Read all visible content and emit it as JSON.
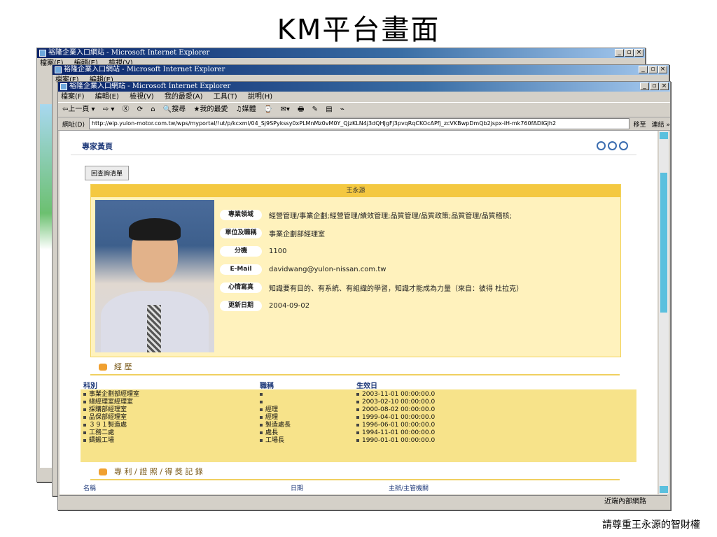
{
  "slide": {
    "title": "KM平台畫面",
    "footer": "請尊重王永源的智財權"
  },
  "browser": {
    "window_title": "裕隆企業入口網站 - Microsoft Internet Explorer",
    "menu": [
      "檔案(F)",
      "編輯(E)",
      "檢視(V)",
      "我的最愛(A)",
      "工具(T)",
      "說明(H)"
    ],
    "toolbar": [
      "⇦上一頁 ▾",
      "⇨ ▾",
      "Ⓧ",
      "⟳",
      "⌂",
      "🔍搜尋",
      "★我的最愛",
      "♫媒體",
      "⌚",
      "✉▾",
      "🖶",
      "✎",
      "▤",
      "⌁"
    ],
    "address_label": "網址(D)",
    "address": "http://eip.yulon-motor.com.tw/wps/myportal/!ut/p/kcxml/04_Sj9SPykssy0xPLMnMz0vM0Y_QjzKLN4j3dQHJgFj3pvqRqCKOcAPfj_zcVKBwpDmQb2jspx-iH-mk760fADIGJh2",
    "go": "移至",
    "links": "連結 »",
    "status_zone": "近端內部網路",
    "controls": {
      "min": "_",
      "max": "▫",
      "close": "×"
    }
  },
  "portlet": {
    "title": "專家黃頁",
    "back_button": "回查詢清單",
    "profile": {
      "name": "王永源",
      "fields": [
        {
          "label": "專業領域",
          "value": "經營管理/事業企劃;經營管理/績效管理;品質管理/品質政策;品質管理/品質稽核;"
        },
        {
          "label": "單位及職稱",
          "value": "事業企劃部經理室"
        },
        {
          "label": "分機",
          "value": "1100"
        },
        {
          "label": "E-Mail",
          "value": "davidwang@yulon-nissan.com.tw"
        },
        {
          "label": "心情寫真",
          "value": "知識要有目的、有系統、有組織的學習，知識才能成為力量（來自：彼得 杜拉克）"
        },
        {
          "label": "更新日期",
          "value": "2004-09-02"
        }
      ]
    },
    "history": {
      "heading": "經 歷",
      "columns": [
        "科別",
        "職稱",
        "生效日"
      ],
      "rows": [
        [
          "事業企劃部經理室",
          "",
          "2003-11-01 00:00:00.0"
        ],
        [
          "總經理室經理室",
          "",
          "2003-02-10 00:00:00.0"
        ],
        [
          "採購部經理室",
          "經理",
          "2000-08-02 00:00:00.0"
        ],
        [
          "品保部經理室",
          "經理",
          "1999-04-01 00:00:00.0"
        ],
        [
          "３９１製造處",
          "製造處長",
          "1996-06-01 00:00:00.0"
        ],
        [
          "工務二處",
          "處長",
          "1994-11-01 00:00:00.0"
        ],
        [
          "鑄鍛工場",
          "工場長",
          "1990-01-01 00:00:00.0"
        ]
      ]
    },
    "patents": {
      "heading": "專 利 / 證 照 / 得 獎 記 錄",
      "columns": [
        "名稱",
        "日期",
        "主辦/主管機關"
      ]
    }
  }
}
